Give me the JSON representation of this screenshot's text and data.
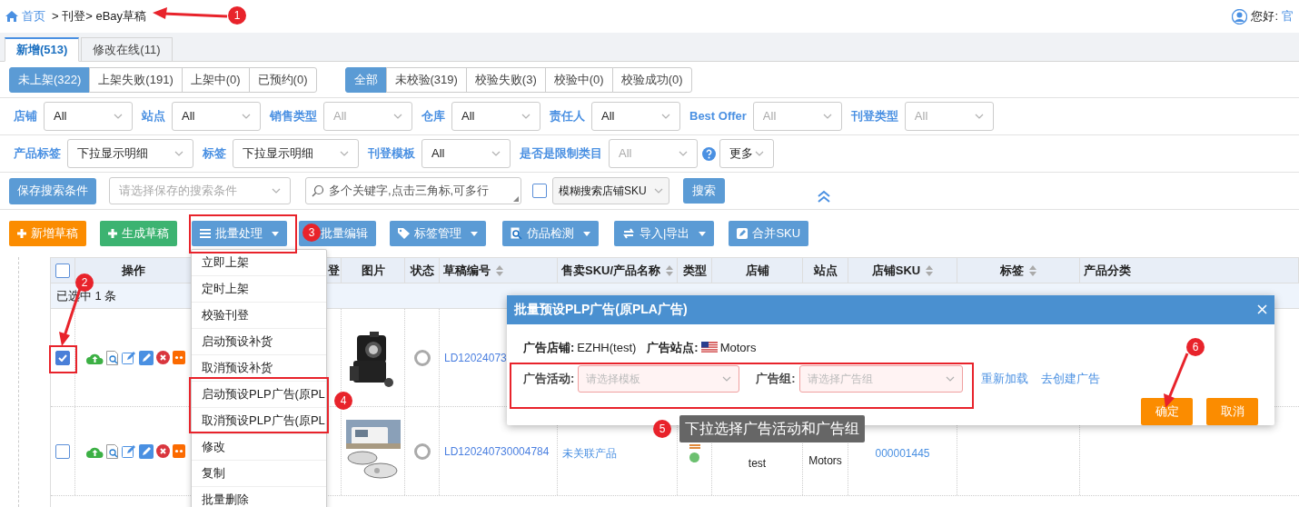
{
  "breadcrumb": {
    "home": "首页",
    "path": "> 刊登> eBay草稿"
  },
  "user": {
    "greeting": "您好:",
    "name": "官"
  },
  "tabs": [
    {
      "label": "新增(513)",
      "selected": true
    },
    {
      "label": "修改在线(11)",
      "selected": false
    }
  ],
  "status_filters": [
    {
      "label": "未上架(322)",
      "selected": true
    },
    {
      "label": "上架失败(191)",
      "selected": false
    },
    {
      "label": "上架中(0)",
      "selected": false
    },
    {
      "label": "已预约(0)",
      "selected": false
    }
  ],
  "check_filters": [
    {
      "label": "全部",
      "selected": true
    },
    {
      "label": "未校验(319)",
      "selected": false
    },
    {
      "label": "校验失败(3)",
      "selected": false
    },
    {
      "label": "校验中(0)",
      "selected": false
    },
    {
      "label": "校验成功(0)",
      "selected": false
    }
  ],
  "filter_row_1": [
    {
      "label": "店铺",
      "value": "All"
    },
    {
      "label": "站点",
      "value": "All"
    },
    {
      "label": "销售类型",
      "placeholder": "All"
    },
    {
      "label": "仓库",
      "value": "All"
    },
    {
      "label": "责任人",
      "value": "All"
    },
    {
      "label": "Best Offer",
      "placeholder": "All"
    },
    {
      "label": "刊登类型",
      "placeholder": "All"
    }
  ],
  "filter_row_2": [
    {
      "label": "产品标签",
      "value": "下拉显示明细"
    },
    {
      "label": "标签",
      "value": "下拉显示明细"
    },
    {
      "label": "刊登模板",
      "value": "All"
    },
    {
      "label": "是否是限制类目",
      "placeholder": "All"
    }
  ],
  "more_select": "更多",
  "search_row": {
    "save_button": "保存搜索条件",
    "saved_placeholder": "请选择保存的搜索条件",
    "keyword_placeholder": "多个关键字,点击三角标,可多行",
    "fuzzy_checked": false,
    "fuzzy_select": "模糊搜索店铺SKU",
    "search_button": "搜索"
  },
  "toolbar": [
    {
      "label": "新增草稿",
      "kind": "add",
      "caret": false
    },
    {
      "label": "生成草稿",
      "kind": "generate",
      "caret": false
    },
    {
      "label": "批量处理",
      "kind": "batch",
      "caret": true
    },
    {
      "label": "批量编辑",
      "kind": "edit",
      "caret": false
    },
    {
      "label": "标签管理",
      "kind": "tag",
      "caret": true
    },
    {
      "label": "仿品检测",
      "kind": "inspect",
      "caret": true
    },
    {
      "label": "导入|导出",
      "kind": "import",
      "caret": true
    },
    {
      "label": "合并SKU",
      "kind": "merge",
      "caret": false
    }
  ],
  "table": {
    "columns": [
      {
        "label": "操作",
        "sortable": false
      },
      {
        "label": "登",
        "sortable": false
      },
      {
        "label": "图片",
        "sortable": false
      },
      {
        "label": "状态",
        "sortable": false
      },
      {
        "label": "草稿编号",
        "sortable": true
      },
      {
        "label": "售卖SKU/产品名称",
        "sortable": true
      },
      {
        "label": "类型",
        "sortable": false
      },
      {
        "label": "店铺",
        "sortable": false
      },
      {
        "label": "站点",
        "sortable": false
      },
      {
        "label": "店铺SKU",
        "sortable": true
      },
      {
        "label": "标签",
        "sortable": true
      },
      {
        "label": "产品分类",
        "sortable": false
      }
    ],
    "header_checked": false,
    "selection_note": "已选中 1 条",
    "rows": [
      {
        "checked": true,
        "status_selected": false,
        "draft_no": "LD12024073"
      },
      {
        "checked": false,
        "status_selected": false,
        "draft_no": "LD120240730004784",
        "product": "未关联产品",
        "shop": "test",
        "site": "Motors",
        "shop_sku": "000001445"
      }
    ]
  },
  "batch_menu": [
    {
      "label": "立即上架"
    },
    {
      "label": "定时上架"
    },
    {
      "label": "校验刊登"
    },
    {
      "label": "启动预设补货"
    },
    {
      "label": "取消预设补货"
    },
    {
      "label": "启动预设PLP广告(原PL"
    },
    {
      "label": "取消预设PLP广告(原PL"
    },
    {
      "label": "修改"
    },
    {
      "label": "复制"
    },
    {
      "label": "批量删除"
    }
  ],
  "dialog": {
    "title": "批量预设PLP广告(原PLA广告)",
    "shop_label": "广告店铺:",
    "shop": "EZHH(test)",
    "site_label": "广告站点:",
    "site": "Motors",
    "campaign_label": "广告活动:",
    "campaign_placeholder": "请选择模板",
    "group_label": "广告组:",
    "group_placeholder": "请选择广告组",
    "links": [
      "重新加载",
      "去创建广告"
    ],
    "confirm": "确定",
    "cancel": "取消"
  },
  "tooltip": "下拉选择广告活动和广告组",
  "annotations": [
    "1",
    "2",
    "3",
    "4",
    "5",
    "6"
  ]
}
